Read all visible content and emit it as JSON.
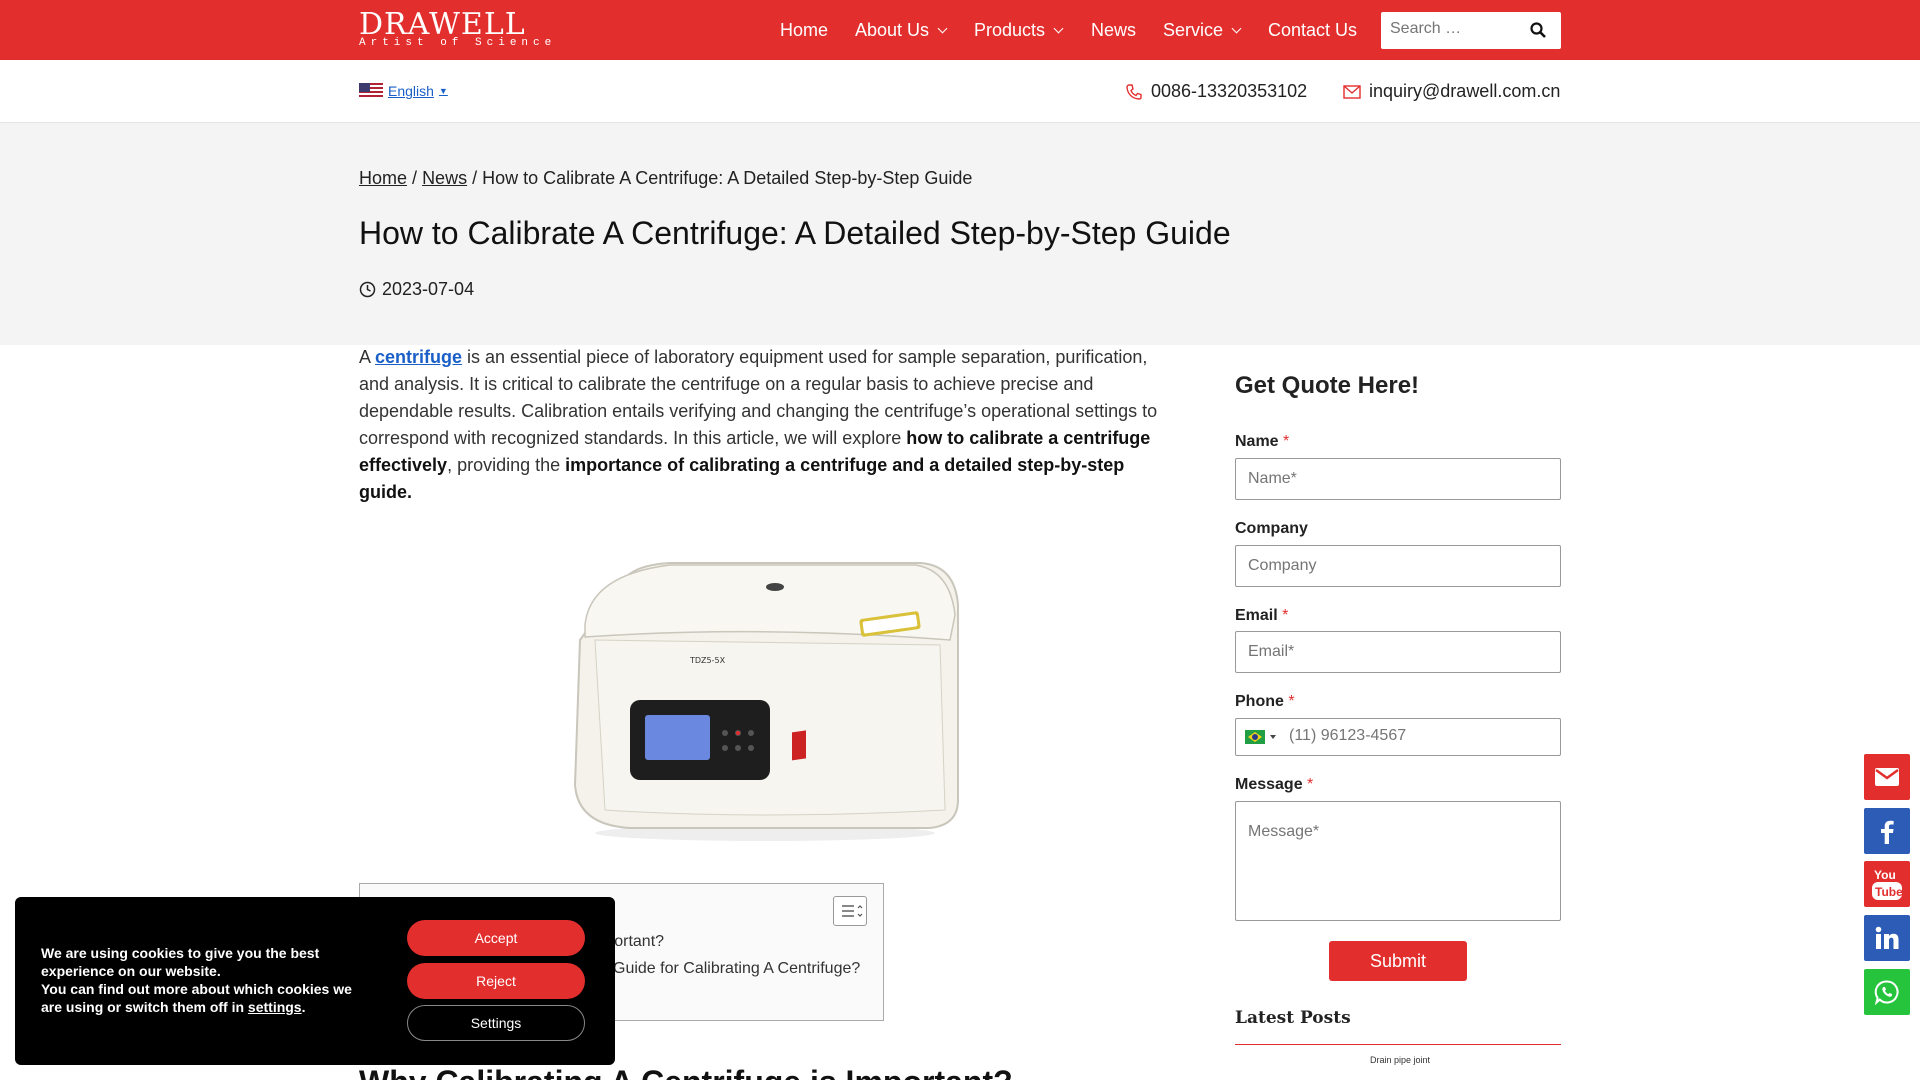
{
  "header": {
    "logo_main": "DRAWELL",
    "logo_tagline": "Artist of Science",
    "nav": [
      {
        "label": "Home"
      },
      {
        "label": "About Us"
      },
      {
        "label": "Products"
      },
      {
        "label": "News"
      },
      {
        "label": "Service"
      },
      {
        "label": "Contact Us"
      }
    ],
    "search_placeholder": "Search …"
  },
  "subheader": {
    "language": "English",
    "phone": "0086-13320353102",
    "email": "inquiry@drawell.com.cn"
  },
  "hero": {
    "breadcrumb": [
      "Home",
      "News",
      "How to Calibrate A Centrifuge: A Detailed Step-by-Step Guide"
    ],
    "breadcrumb_sep": "/",
    "title": "How to Calibrate A Centrifuge: A Detailed Step-by-Step Guide",
    "date": "2023-07-04"
  },
  "article": {
    "p1_a": "A ",
    "p1_link": "centrifuge",
    "p1_b": " is an essential piece of laboratory equipment used for sample separation, purification, and analysis. It is critical to calibrate the centrifuge on a regular basis to achieve precise and dependable results. Calibration entails verifying and changing the centrifuge’s operational settings to correspond with recognized standards. In this article, we will explore ",
    "p1_bold1": "how to calibrate a centrifuge effectively",
    "p1_c": ", providing the ",
    "p1_bold2": "importance of calibrating a centrifuge and a detailed step-by-step guide.",
    "product_label": "TDZ5-5X",
    "toc_rows": [
      "mportant?",
      "Guide for Calibrating A Centrifuge?"
    ],
    "h2": "Why Calibrating A Centrifuge is Important?"
  },
  "form": {
    "heading": "Get Quote Here!",
    "name_label": "Name",
    "name_placeholder": "Name*",
    "company_label": "Company",
    "company_placeholder": "Company",
    "email_label": "Email",
    "email_placeholder": "Email*",
    "phone_label": "Phone",
    "phone_placeholder": "(11) 96123-4567",
    "message_label": "Message",
    "message_placeholder": "Message*",
    "required_mark": "*",
    "submit": "Submit",
    "latest_posts": "Latest Posts",
    "thumb_caption": "Drain pipe joint"
  },
  "cookie": {
    "line1": "We are using cookies to give you the best experience on our website.",
    "line2": "You can find out more about which cookies we are using or switch them off in ",
    "settings_link": "settings",
    "accept": "Accept",
    "reject": "Reject",
    "settings": "Settings"
  },
  "social": [
    "email-icon",
    "facebook-icon",
    "youtube-icon",
    "linkedin-icon",
    "whatsapp-icon"
  ],
  "colors": {
    "brand_red": "#e32e2e",
    "facebook": "#2d5cb7",
    "linkedin": "#2d5cb7",
    "whatsapp": "#25c43c"
  }
}
